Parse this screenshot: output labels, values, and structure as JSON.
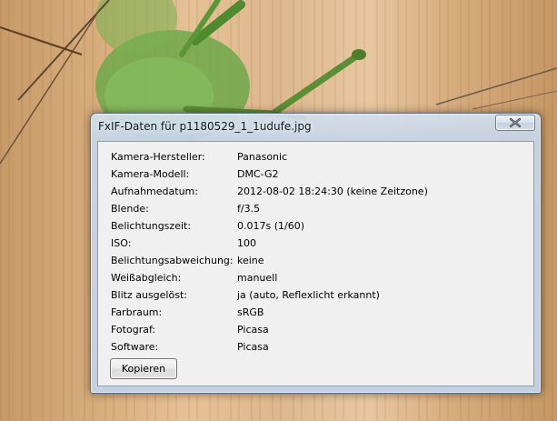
{
  "window": {
    "title": "FxIF-Daten für p1180529_1_1udufe.jpg",
    "close_icon": "close-icon"
  },
  "exif": [
    {
      "label": "Kamera-Hersteller:",
      "value": "Panasonic"
    },
    {
      "label": "Kamera-Modell:",
      "value": "DMC-G2"
    },
    {
      "label": "Aufnahmedatum:",
      "value": "2012-08-02 18:24:30 (keine Zeitzone)"
    },
    {
      "label": "Blende:",
      "value": "f/3.5"
    },
    {
      "label": "Belichtungszeit:",
      "value": "0.017s (1/60)"
    },
    {
      "label": "ISO:",
      "value": "100"
    },
    {
      "label": "Belichtungsabweichung:",
      "value": "keine"
    },
    {
      "label": "Weißabgleich:",
      "value": "manuell"
    },
    {
      "label": "Blitz ausgelöst:",
      "value": "ja (auto, Reflexlicht erkannt)"
    },
    {
      "label": "Farbraum:",
      "value": "sRGB"
    },
    {
      "label": "Fotograf:",
      "value": "Picasa"
    },
    {
      "label": "Software:",
      "value": "Picasa"
    }
  ],
  "actions": {
    "copy_label": "Kopieren"
  },
  "colors": {
    "wood": "#d8ad7d",
    "insect_green": "#5e9a3a",
    "frame_glass": "#c7d6e8",
    "client_bg": "#f0f0f0",
    "close_red": "#c0392b"
  }
}
